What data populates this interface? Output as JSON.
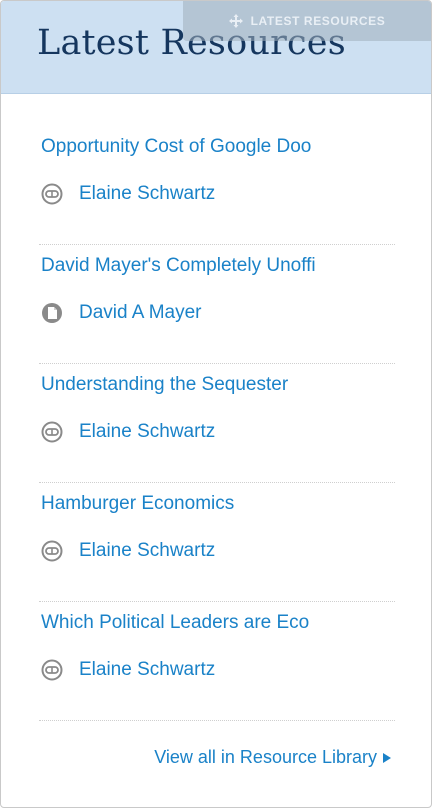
{
  "widget": {
    "title": "Latest Resources",
    "drag_tab_label": "LATEST RESOURCES"
  },
  "items": [
    {
      "title": "Opportunity Cost of Google Doo",
      "author": "Elaine Schwartz",
      "icon": "cc-icon"
    },
    {
      "title": "David Mayer's Completely Unoffi",
      "author": "David A Mayer",
      "icon": "document-icon"
    },
    {
      "title": "Understanding the Sequester",
      "author": "Elaine Schwartz",
      "icon": "cc-icon"
    },
    {
      "title": "Hamburger Economics",
      "author": "Elaine Schwartz",
      "icon": "cc-icon"
    },
    {
      "title": "Which Political Leaders are Eco",
      "author": "Elaine Schwartz",
      "icon": "cc-icon"
    }
  ],
  "footer": {
    "view_all_label": "View all in Resource Library"
  },
  "colors": {
    "header_bg": "#cde0f2",
    "title_text": "#15365e",
    "link": "#1a82c8"
  }
}
